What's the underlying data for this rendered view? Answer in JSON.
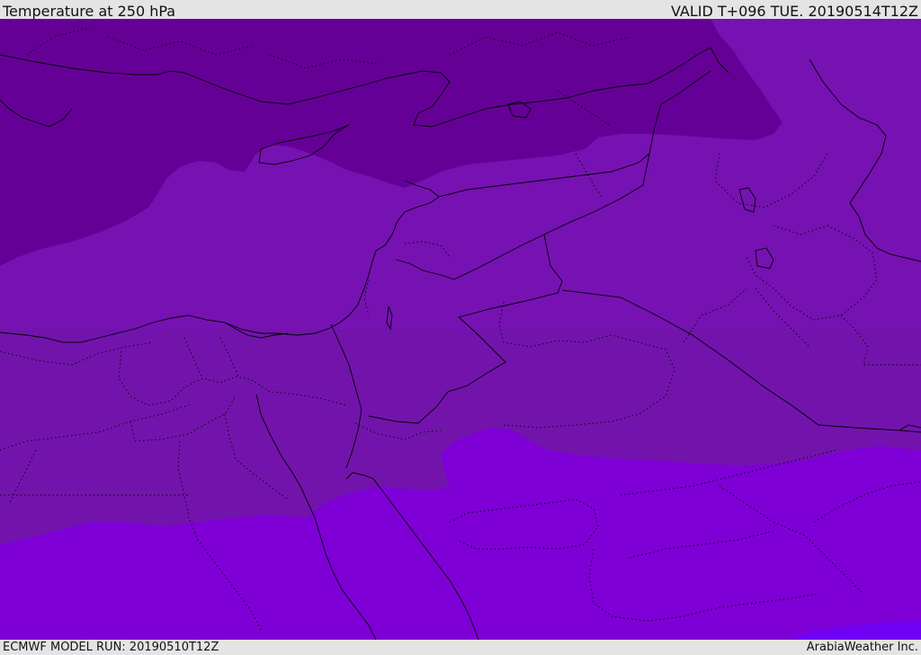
{
  "header": {
    "title": "Temperature at 250 hPa",
    "valid": "VALID T+096 TUE. 20190514T12Z"
  },
  "footer": {
    "model_run": "ECMWF MODEL RUN: 20190510T12Z",
    "credit": "ArabiaWeather Inc."
  },
  "map": {
    "field": "temperature",
    "level": "250 hPa",
    "region": "Eastern Mediterranean / Middle East",
    "colors": {
      "coldest_band": "#650097",
      "cold_band": "#7612b2",
      "mid_band": "#7214ac",
      "warm_band": "#7e00d6",
      "warmest_band": "#7000f2",
      "coastline": "#000000",
      "border": "#000000"
    },
    "contour_bands_count": 5
  }
}
